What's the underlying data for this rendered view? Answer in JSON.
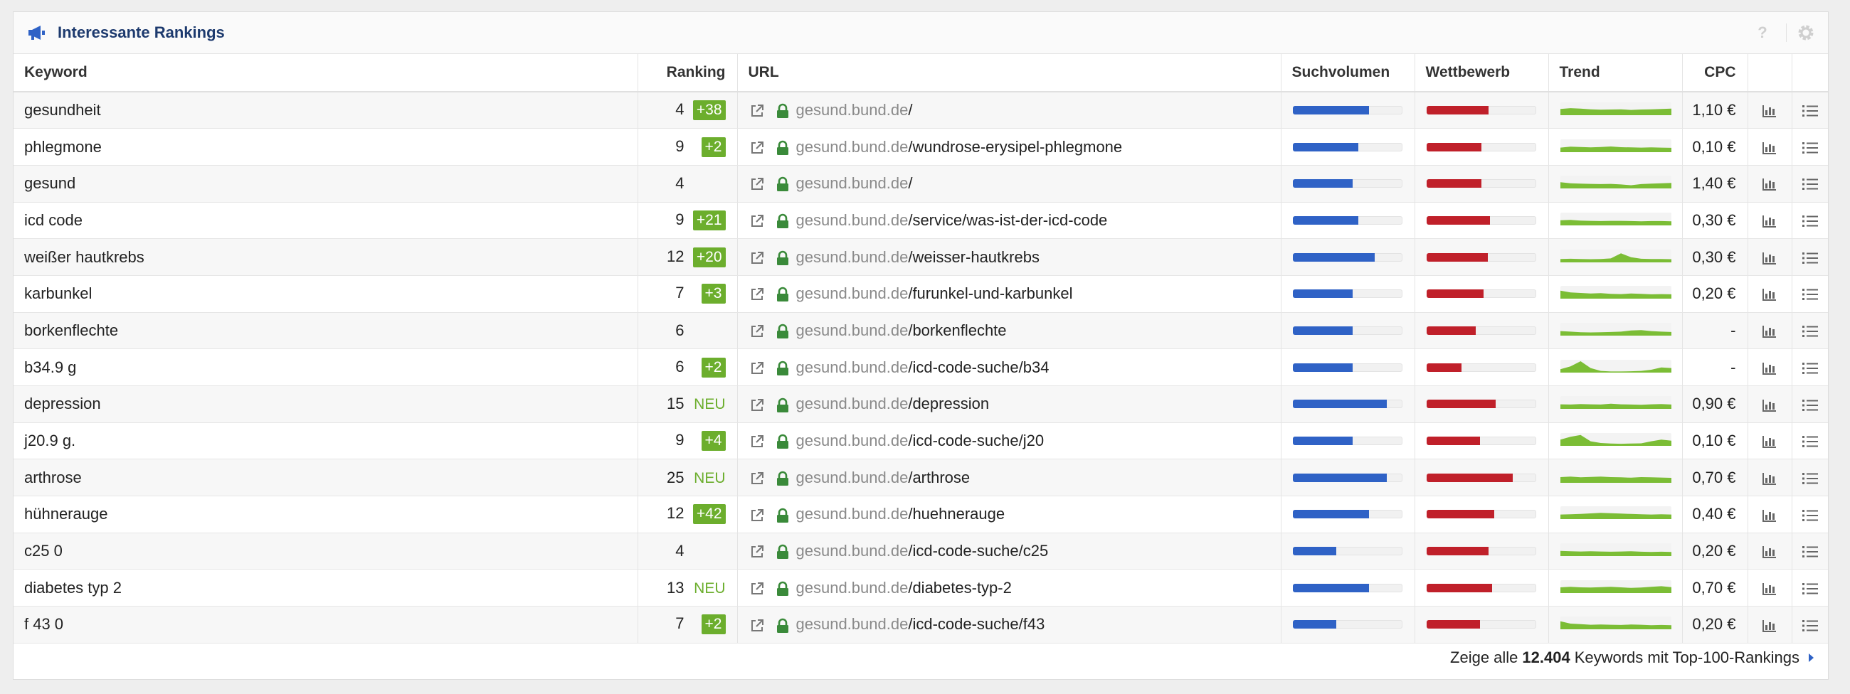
{
  "panel": {
    "title": "Interessante Rankings",
    "help": "?"
  },
  "columns": {
    "keyword": "Keyword",
    "ranking": "Ranking",
    "url": "URL",
    "suchvolumen": "Suchvolumen",
    "wettbewerb": "Wettbewerb",
    "trend": "Trend",
    "cpc": "CPC"
  },
  "colors": {
    "accent": "#1d3a6e",
    "positive": "#6cae2d",
    "volume": "#2f62c6",
    "competition": "#c0202a",
    "secure": "#3a8a3a"
  },
  "rows": [
    {
      "keyword": "gesundheit",
      "rank": "4",
      "change": "+38",
      "change_type": "badge",
      "domain": "gesund.bund.de",
      "path": "/",
      "volume": 0.7,
      "competition": 0.57,
      "trend": [
        0.55,
        0.62,
        0.58,
        0.52,
        0.48,
        0.5,
        0.52,
        0.46,
        0.5,
        0.52,
        0.55,
        0.58
      ],
      "cpc": "1,10 €"
    },
    {
      "keyword": "phlegmone",
      "rank": "9",
      "change": "+2",
      "change_type": "badge",
      "domain": "gesund.bund.de",
      "path": "/wundrose-erysipel-phlegmone",
      "volume": 0.6,
      "competition": 0.5,
      "trend": [
        0.4,
        0.48,
        0.45,
        0.42,
        0.45,
        0.5,
        0.44,
        0.42,
        0.4,
        0.42,
        0.4,
        0.38
      ],
      "cpc": "0,10 €"
    },
    {
      "keyword": "gesund",
      "rank": "4",
      "change": "",
      "change_type": "none",
      "domain": "gesund.bund.de",
      "path": "/",
      "volume": 0.55,
      "competition": 0.5,
      "trend": [
        0.55,
        0.45,
        0.42,
        0.4,
        0.38,
        0.4,
        0.35,
        0.28,
        0.38,
        0.42,
        0.45,
        0.48
      ],
      "cpc": "1,40 €"
    },
    {
      "keyword": "icd code",
      "rank": "9",
      "change": "+21",
      "change_type": "badge",
      "domain": "gesund.bund.de",
      "path": "/service/was-ist-der-icd-code",
      "volume": 0.6,
      "competition": 0.58,
      "trend": [
        0.45,
        0.48,
        0.42,
        0.4,
        0.38,
        0.4,
        0.4,
        0.38,
        0.36,
        0.38,
        0.38,
        0.36
      ],
      "cpc": "0,30 €"
    },
    {
      "keyword": "weißer hautkrebs",
      "rank": "12",
      "change": "+20",
      "change_type": "badge",
      "domain": "gesund.bund.de",
      "path": "/weisser-hautkrebs",
      "volume": 0.75,
      "competition": 0.56,
      "trend": [
        0.3,
        0.32,
        0.3,
        0.28,
        0.3,
        0.35,
        0.8,
        0.45,
        0.32,
        0.3,
        0.3,
        0.28
      ],
      "cpc": "0,30 €"
    },
    {
      "keyword": "karbunkel",
      "rank": "7",
      "change": "+3",
      "change_type": "badge",
      "domain": "gesund.bund.de",
      "path": "/furunkel-und-karbunkel",
      "volume": 0.55,
      "competition": 0.52,
      "trend": [
        0.7,
        0.55,
        0.5,
        0.45,
        0.48,
        0.42,
        0.4,
        0.45,
        0.42,
        0.38,
        0.4,
        0.38
      ],
      "cpc": "0,20 €"
    },
    {
      "keyword": "borkenflechte",
      "rank": "6",
      "change": "",
      "change_type": "none",
      "domain": "gesund.bund.de",
      "path": "/borkenflechte",
      "volume": 0.55,
      "competition": 0.45,
      "trend": [
        0.4,
        0.35,
        0.3,
        0.28,
        0.3,
        0.32,
        0.35,
        0.45,
        0.48,
        0.4,
        0.35,
        0.32
      ],
      "cpc": "-"
    },
    {
      "keyword": "b34.9 g",
      "rank": "6",
      "change": "+2",
      "change_type": "badge",
      "domain": "gesund.bund.de",
      "path": "/icd-code-suche/b34",
      "volume": 0.55,
      "competition": 0.32,
      "trend": [
        0.3,
        0.55,
        1.0,
        0.4,
        0.15,
        0.1,
        0.1,
        0.12,
        0.15,
        0.25,
        0.45,
        0.4
      ],
      "cpc": "-"
    },
    {
      "keyword": "depression",
      "rank": "15",
      "change": "NEU",
      "change_type": "neu",
      "domain": "gesund.bund.de",
      "path": "/depression",
      "volume": 0.86,
      "competition": 0.63,
      "trend": [
        0.4,
        0.38,
        0.42,
        0.4,
        0.38,
        0.45,
        0.4,
        0.38,
        0.36,
        0.4,
        0.42,
        0.38
      ],
      "cpc": "0,90 €"
    },
    {
      "keyword": "j20.9 g.",
      "rank": "9",
      "change": "+4",
      "change_type": "badge",
      "domain": "gesund.bund.de",
      "path": "/icd-code-suche/j20",
      "volume": 0.55,
      "competition": 0.49,
      "trend": [
        0.55,
        0.8,
        0.95,
        0.4,
        0.25,
        0.2,
        0.18,
        0.2,
        0.22,
        0.4,
        0.55,
        0.45
      ],
      "cpc": "0,10 €"
    },
    {
      "keyword": "arthrose",
      "rank": "25",
      "change": "NEU",
      "change_type": "neu",
      "domain": "gesund.bund.de",
      "path": "/arthrose",
      "volume": 0.86,
      "competition": 0.79,
      "trend": [
        0.5,
        0.55,
        0.48,
        0.52,
        0.55,
        0.5,
        0.48,
        0.45,
        0.5,
        0.48,
        0.46,
        0.44
      ],
      "cpc": "0,70 €"
    },
    {
      "keyword": "hühnerauge",
      "rank": "12",
      "change": "+42",
      "change_type": "badge",
      "domain": "gesund.bund.de",
      "path": "/huehnerauge",
      "volume": 0.7,
      "competition": 0.62,
      "trend": [
        0.4,
        0.42,
        0.45,
        0.5,
        0.55,
        0.52,
        0.48,
        0.45,
        0.42,
        0.4,
        0.42,
        0.4
      ],
      "cpc": "0,40 €"
    },
    {
      "keyword": "c25 0",
      "rank": "4",
      "change": "",
      "change_type": "none",
      "domain": "gesund.bund.de",
      "path": "/icd-code-suche/c25",
      "volume": 0.4,
      "competition": 0.57,
      "trend": [
        0.45,
        0.42,
        0.4,
        0.42,
        0.4,
        0.38,
        0.4,
        0.42,
        0.38,
        0.36,
        0.38,
        0.36
      ],
      "cpc": "0,20 €"
    },
    {
      "keyword": "diabetes typ 2",
      "rank": "13",
      "change": "NEU",
      "change_type": "neu",
      "domain": "gesund.bund.de",
      "path": "/diabetes-typ-2",
      "volume": 0.7,
      "competition": 0.6,
      "trend": [
        0.5,
        0.55,
        0.5,
        0.48,
        0.52,
        0.55,
        0.5,
        0.45,
        0.48,
        0.55,
        0.6,
        0.52
      ],
      "cpc": "0,70 €"
    },
    {
      "keyword": "f 43 0",
      "rank": "7",
      "change": "+2",
      "change_type": "badge",
      "domain": "gesund.bund.de",
      "path": "/icd-code-suche/f43",
      "volume": 0.4,
      "competition": 0.49,
      "trend": [
        0.7,
        0.5,
        0.45,
        0.4,
        0.42,
        0.4,
        0.38,
        0.42,
        0.4,
        0.36,
        0.38,
        0.36
      ],
      "cpc": "0,20 €"
    }
  ],
  "footer": {
    "prefix": "Zeige alle",
    "count": "12.404",
    "suffix": "Keywords mit Top-100-Rankings"
  }
}
